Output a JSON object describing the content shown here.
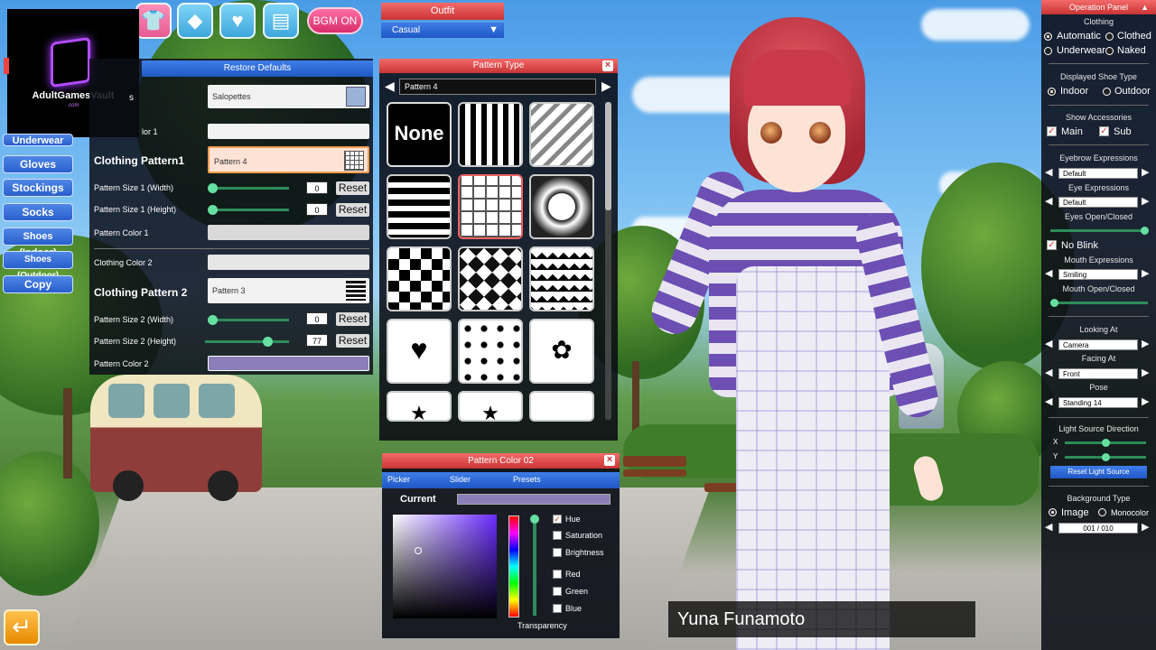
{
  "watermark": {
    "name": "AdultGamesVault",
    "sub": ".com"
  },
  "top_bar": {
    "icons": [
      "shirt-icon",
      "diamond-icon",
      "heart-icon",
      "document-icon"
    ],
    "bgm_label": "BGM ON"
  },
  "left_menu": {
    "partial_item": "Underwear",
    "items": [
      "Gloves",
      "Stockings",
      "Socks",
      "Shoes (Indoor)",
      "Shoes (Outdoor)",
      "Copy"
    ]
  },
  "settings": {
    "restore_label": "Restore Defaults",
    "clothing_type_label": "s",
    "clothing_type_value": "Salopettes",
    "clothing_color_1_label": "lor 1",
    "pattern1_label": "Clothing Pattern1",
    "pattern1_value": "Pattern 4",
    "pattern_size1_w_label": "Pattern Size 1 (Width)",
    "pattern_size1_w_value": "0",
    "pattern_size1_h_label": "Pattern Size 1 (Height)",
    "pattern_size1_h_value": "0",
    "pattern_color1_label": "Pattern Color 1",
    "clothing_color_2_label": "Clothing Color 2",
    "pattern2_label": "Clothing Pattern 2",
    "pattern2_value": "Pattern 3",
    "pattern_size2_w_label": "Pattern Size 2 (Width)",
    "pattern_size2_w_value": "0",
    "pattern_size2_h_label": "Pattern Size 2 (Height)",
    "pattern_size2_h_value": "77",
    "pattern_color2_label": "Pattern Color 2",
    "reset_label": "Reset",
    "pattern_color2_hex": "#8a7fb8"
  },
  "outfit": {
    "title": "Outfit",
    "value": "Casual"
  },
  "pattern_type": {
    "title": "Pattern Type",
    "current": "Pattern 4",
    "none_label": "None"
  },
  "color_panel": {
    "title": "Pattern Color 02",
    "tabs": [
      "Picker",
      "Slider",
      "Presets"
    ],
    "current_label": "Current",
    "current_color": "#8a7fb8",
    "checks": [
      {
        "label": "Hue",
        "checked": true
      },
      {
        "label": "Saturation",
        "checked": false
      },
      {
        "label": "Brightness",
        "checked": false
      },
      {
        "label": "Red",
        "checked": false
      },
      {
        "label": "Green",
        "checked": false
      },
      {
        "label": "Blue",
        "checked": false
      }
    ],
    "transparency_label": "Transparency"
  },
  "operation_panel": {
    "title": "Operation Panel",
    "clothing_title": "Clothing",
    "clothing_options": [
      "Automatic",
      "Clothed",
      "Underwear",
      "Naked"
    ],
    "shoe_title": "Displayed Shoe Type",
    "shoe_options": [
      "Indoor",
      "Outdoor"
    ],
    "accessories_title": "Show Accessories",
    "accessories": [
      "Main",
      "Sub"
    ],
    "eyebrow_title": "Eyebrow Expressions",
    "eyebrow_value": "Default",
    "eye_title": "Eye Expressions",
    "eye_value": "Default",
    "eyes_open_title": "Eyes Open/Closed",
    "no_blink_label": "No Blink",
    "mouth_title": "Mouth Expressions",
    "mouth_value": "Smiling",
    "mouth_open_title": "Mouth Open/Closed",
    "looking_title": "Looking At",
    "looking_value": "Camera",
    "facing_title": "Facing At",
    "facing_value": "Front",
    "pose_title": "Pose",
    "pose_value": "Standing 14",
    "light_title": "Light Source Direction",
    "light_x_label": "X",
    "light_y_label": "Y",
    "reset_light_label": "Reset Light Source",
    "bg_title": "Background Type",
    "bg_options": [
      "Image",
      "Monocolor"
    ],
    "bg_value": "001 / 010"
  },
  "nameplate": {
    "name": "Yuna Funamoto"
  }
}
